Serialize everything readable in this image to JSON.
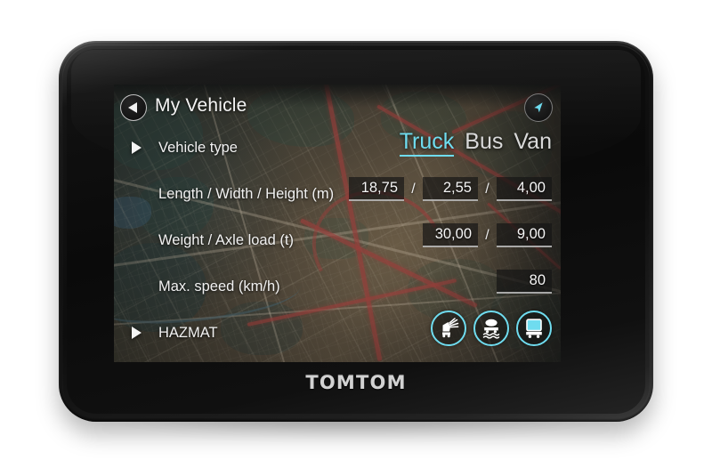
{
  "device": {
    "brand": "TOMTOM"
  },
  "screen": {
    "header": {
      "back_label": "back-arrow",
      "title": "My Vehicle",
      "nav_label": "navigation-arrow"
    },
    "rows": [
      {
        "label": "Vehicle type",
        "has_chevron": true
      },
      {
        "label": "Length / Width / Height (m)",
        "has_chevron": false
      },
      {
        "label": "Weight / Axle load (t)",
        "has_chevron": false
      },
      {
        "label": "Max. speed (km/h)",
        "has_chevron": false
      },
      {
        "label": "HAZMAT",
        "has_chevron": true
      }
    ],
    "vehicle_types": [
      {
        "label": "Truck",
        "selected": true
      },
      {
        "label": "Bus",
        "selected": false
      },
      {
        "label": "Van",
        "selected": false
      }
    ],
    "dimensions": {
      "length": "18,75",
      "separator_1": "/",
      "width": "2,55",
      "separator_2": "/",
      "height": "4,00"
    },
    "weight": {
      "gross_weight": "30,00",
      "separator": "/",
      "axle_load": "9,00"
    },
    "max_speed": {
      "value": "80"
    },
    "hazmat_icons": [
      {
        "name": "explosive-goods-icon",
        "selected": false
      },
      {
        "name": "water-pollutant-goods-icon",
        "selected": false
      },
      {
        "name": "general-hazardous-goods-icon",
        "selected": true
      }
    ],
    "colors": {
      "accent": "#6fdcef",
      "text": "#f1f1f1",
      "field_background": "#141414",
      "field_underline": "#dedede"
    }
  }
}
